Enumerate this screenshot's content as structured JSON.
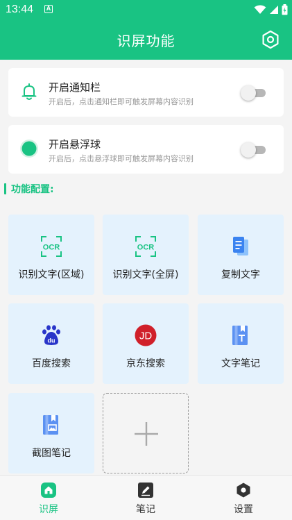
{
  "status_bar": {
    "time": "13:44",
    "notification_icon": "A"
  },
  "header": {
    "title": "识屏功能",
    "settings_icon": "hexagon-gear-icon"
  },
  "settings": [
    {
      "title": "开启通知栏",
      "desc": "开启后，点击通知栏即可触发屏幕内容识别",
      "icon": "bell-icon",
      "enabled": false
    },
    {
      "title": "开启悬浮球",
      "desc": "开启后，点击悬浮球即可触发屏幕内容识别",
      "icon": "floating-ball-icon",
      "enabled": false
    }
  ],
  "section": {
    "label": "功能配置:"
  },
  "functions": [
    {
      "label": "识别文字(区域)",
      "icon": "ocr-icon"
    },
    {
      "label": "识别文字(全屏)",
      "icon": "ocr-icon"
    },
    {
      "label": "复制文字",
      "icon": "copy-document-icon"
    },
    {
      "label": "百度搜索",
      "icon": "baidu-paw-icon"
    },
    {
      "label": "京东搜索",
      "icon": "jd-logo-icon"
    },
    {
      "label": "文字笔记",
      "icon": "text-note-icon"
    },
    {
      "label": "截图笔记",
      "icon": "image-note-icon"
    }
  ],
  "add_tile": {
    "icon": "plus-icon"
  },
  "nav": [
    {
      "label": "识屏",
      "icon": "home-icon",
      "active": true
    },
    {
      "label": "笔记",
      "icon": "note-edit-icon",
      "active": false
    },
    {
      "label": "设置",
      "icon": "settings-hexagon-icon",
      "active": false
    }
  ],
  "colors": {
    "brand": "#19c383",
    "tile_bg": "#e4f2fd",
    "icon_blue": "#3a83f0",
    "jd_red": "#d0202a",
    "nav_inactive": "#333333"
  }
}
